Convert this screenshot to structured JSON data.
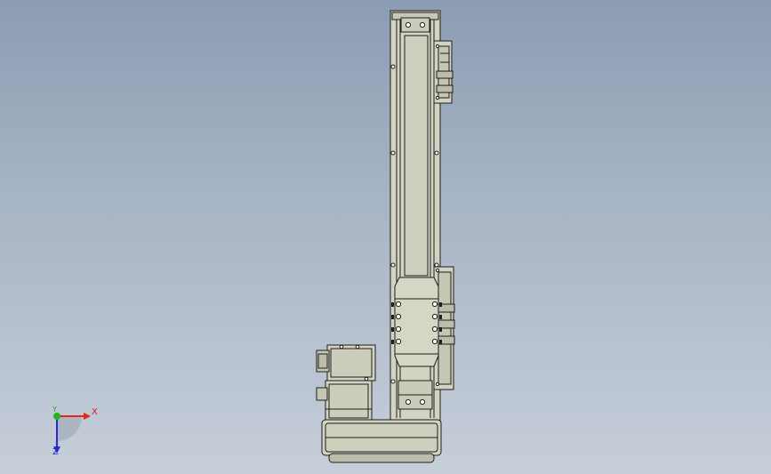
{
  "scene": {
    "background_top": "#8c9cb2",
    "background_bottom": "#c6ced9",
    "part_fill": "#d3d3c2",
    "part_edge": "#1e1e1e",
    "part_shade": "#bcbcab"
  },
  "triad": {
    "x_label": "X",
    "y_label": "Y",
    "z_label": "Z",
    "x_color": "#e0281c",
    "y_color": "#22b422",
    "z_color": "#2a2ad0"
  }
}
